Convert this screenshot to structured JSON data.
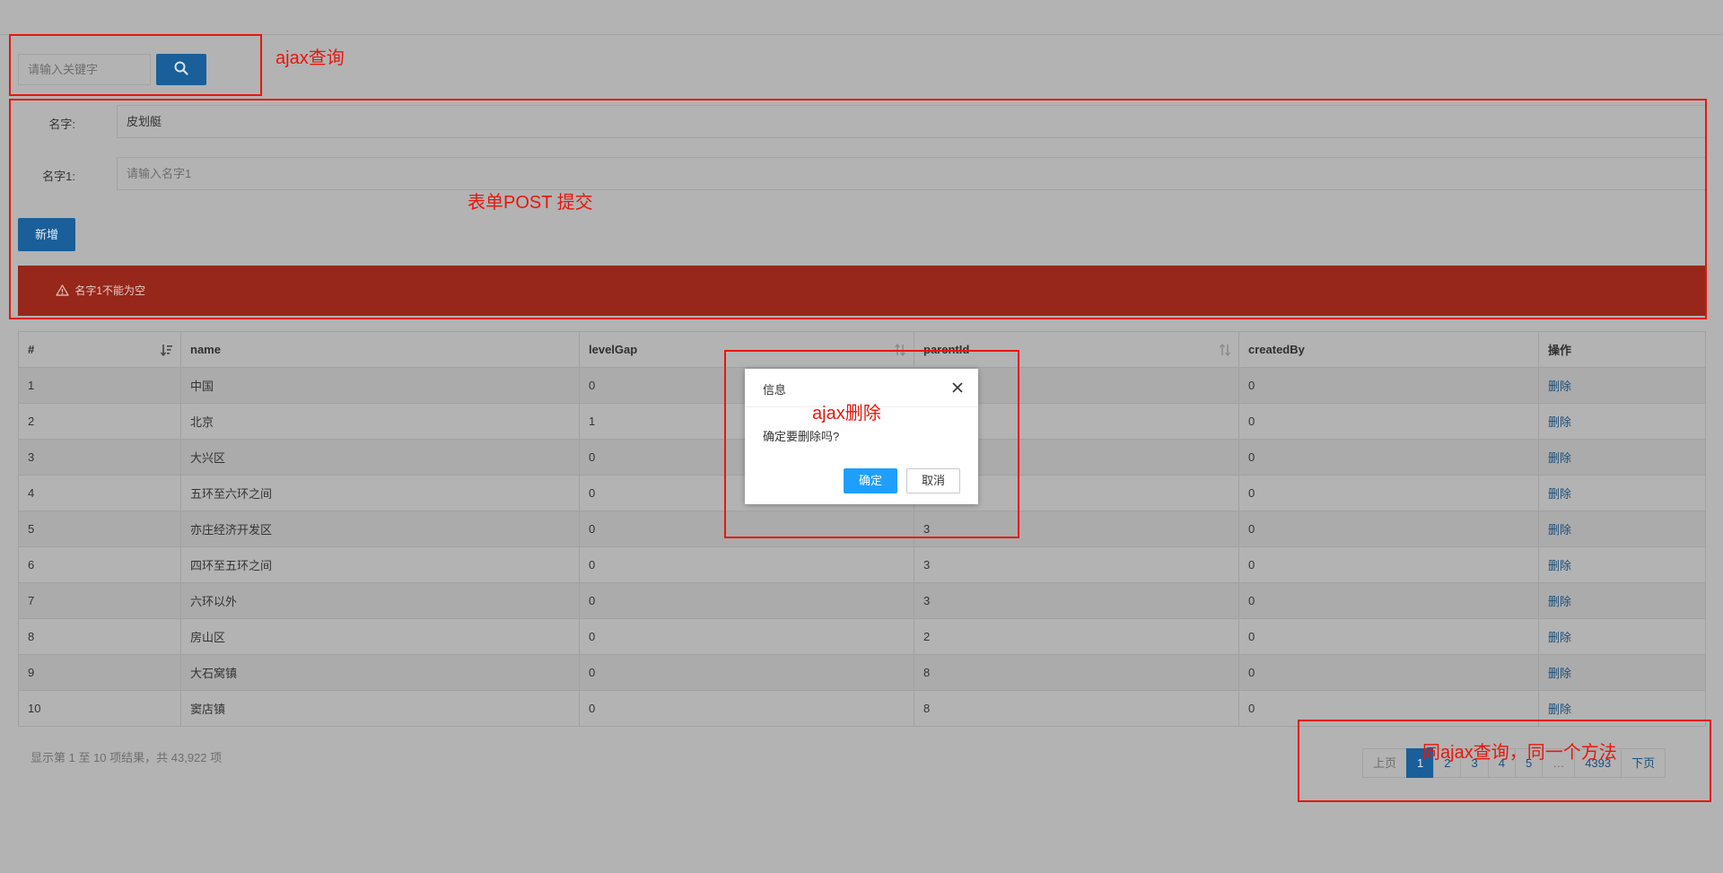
{
  "search": {
    "placeholder": "请输入关键字"
  },
  "form": {
    "name_label": "名字:",
    "name_value": "皮划艇",
    "name1_label": "名字1:",
    "name1_placeholder": "请输入名字1",
    "add_label": "新增",
    "error_message": "名字1不能为空"
  },
  "table": {
    "columns": [
      "#",
      "name",
      "levelGap",
      "parentId",
      "createdBy",
      "操作"
    ],
    "rows": [
      {
        "id": "1",
        "name": "中国",
        "levelGap": "0",
        "parentId": "",
        "createdBy": "0",
        "action": "删除"
      },
      {
        "id": "2",
        "name": "北京",
        "levelGap": "1",
        "parentId": "",
        "createdBy": "0",
        "action": "删除"
      },
      {
        "id": "3",
        "name": "大兴区",
        "levelGap": "0",
        "parentId": "",
        "createdBy": "0",
        "action": "删除"
      },
      {
        "id": "4",
        "name": "五环至六环之间",
        "levelGap": "0",
        "parentId": "",
        "createdBy": "0",
        "action": "删除"
      },
      {
        "id": "5",
        "name": "亦庄经济开发区",
        "levelGap": "0",
        "parentId": "3",
        "createdBy": "0",
        "action": "删除"
      },
      {
        "id": "6",
        "name": "四环至五环之间",
        "levelGap": "0",
        "parentId": "3",
        "createdBy": "0",
        "action": "删除"
      },
      {
        "id": "7",
        "name": "六环以外",
        "levelGap": "0",
        "parentId": "3",
        "createdBy": "0",
        "action": "删除"
      },
      {
        "id": "8",
        "name": "房山区",
        "levelGap": "0",
        "parentId": "2",
        "createdBy": "0",
        "action": "删除"
      },
      {
        "id": "9",
        "name": "大石窝镇",
        "levelGap": "0",
        "parentId": "8",
        "createdBy": "0",
        "action": "删除"
      },
      {
        "id": "10",
        "name": "窦店镇",
        "levelGap": "0",
        "parentId": "8",
        "createdBy": "0",
        "action": "删除"
      }
    ]
  },
  "info_text": "显示第 1 至 10 项结果，共 43,922 项",
  "pagination": {
    "prev": "上页",
    "pages": [
      "1",
      "2",
      "3",
      "4",
      "5"
    ],
    "ellipsis": "…",
    "last": "4393",
    "next": "下页",
    "current": "1"
  },
  "dialog": {
    "title": "信息",
    "message": "确定要删除吗?",
    "ok": "确定",
    "cancel": "取消"
  },
  "annotations": {
    "search": "ajax查询",
    "form": "表单POST 提交",
    "delete": "ajax删除",
    "pagination": "同ajax查询，同一个方法"
  },
  "colors": {
    "primary": "#1a5f99",
    "alert": "#96271a",
    "annotation": "#e8160c",
    "dialog_ok": "#1e9fff"
  }
}
